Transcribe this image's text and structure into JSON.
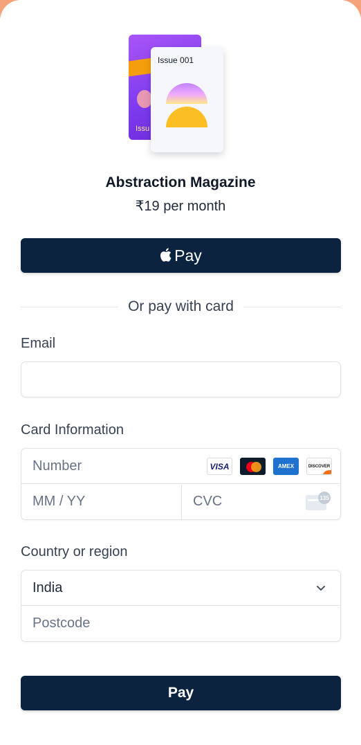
{
  "product": {
    "back_cover_label": "Issu",
    "front_cover_label": "Issue 001",
    "name": "Abstraction Magazine",
    "price": "₹19 per month"
  },
  "apple_pay": {
    "label": "Pay"
  },
  "divider": {
    "text": "Or pay with card"
  },
  "email": {
    "label": "Email",
    "value": ""
  },
  "card": {
    "label": "Card Information",
    "number_placeholder": "Number",
    "expiry_placeholder": "MM / YY",
    "cvc_placeholder": "CVC",
    "cvc_hint": "135",
    "brands": [
      "VISA",
      "AMEX",
      "DISCOVER"
    ]
  },
  "country": {
    "label": "Country or region",
    "selected": "India",
    "postcode_placeholder": "Postcode"
  },
  "pay_button": {
    "label": "Pay"
  },
  "colors": {
    "primary_button": "#0c2340",
    "accent": "#f4a37a"
  }
}
